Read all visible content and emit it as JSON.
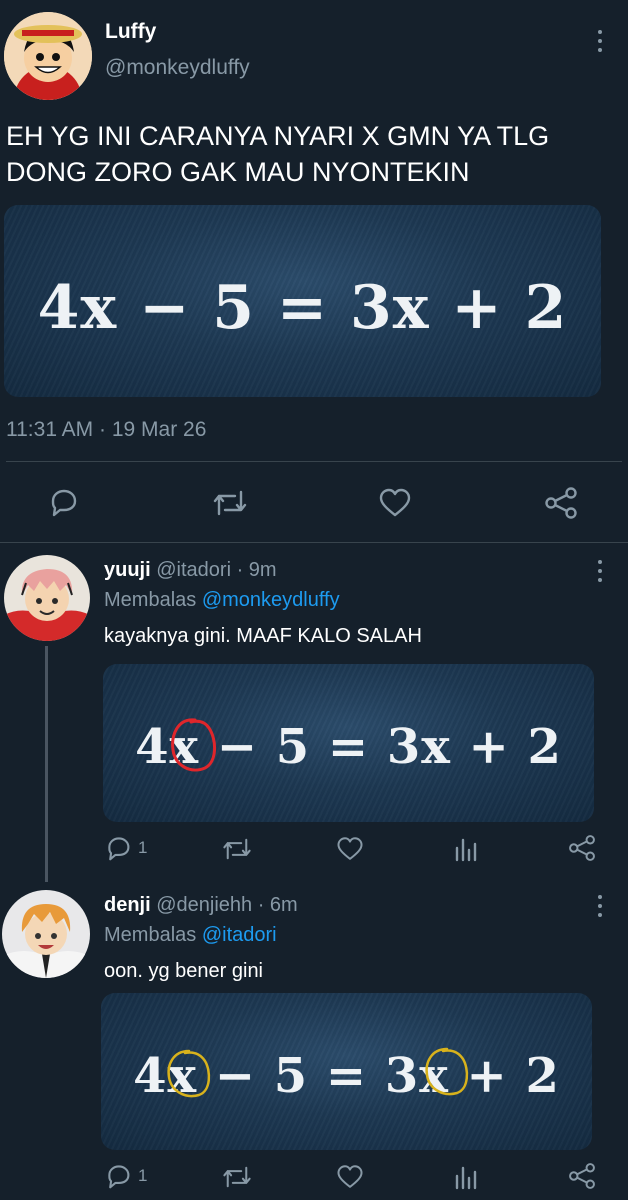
{
  "main_tweet": {
    "author_name": "Luffy",
    "author_handle": "@monkeydluffy",
    "text_line1": "EH YG INI CARANYA NYARI X GMN YA TLG",
    "text_line2": "DONG ZORO GAK MAU NYONTEKIN",
    "equation": "4x − 5 = 3x + 2",
    "timestamp": "11:31 AM · 19 Mar 26"
  },
  "replies": [
    {
      "author_name": "yuuji",
      "author_handle": "@itadori · 9m",
      "replying_prefix": "Membalas",
      "replying_to": "@monkeydluffy",
      "text": "kayaknya gini. MAAF KALO SALAH",
      "equation": "4x − 5 = 3x + 2",
      "reply_count": "1",
      "circle_color": "#e0262b"
    },
    {
      "author_name": "denji",
      "author_handle": "@denjiehh · 6m",
      "replying_prefix": "Membalas",
      "replying_to": "@itadori",
      "text": "oon. yg bener gini",
      "equation": "4x − 5 = 3x + 2",
      "reply_count": "1",
      "circle_color": "#d8b21c"
    }
  ],
  "icons": {
    "reply": "reply-icon",
    "retweet": "retweet-icon",
    "like": "heart-icon",
    "share": "share-icon",
    "analytics": "analytics-icon",
    "more": "more-options-icon"
  },
  "colors": {
    "background": "#15202b",
    "muted": "#8899a6",
    "link": "#1d9bf0",
    "divider": "#38444d"
  }
}
